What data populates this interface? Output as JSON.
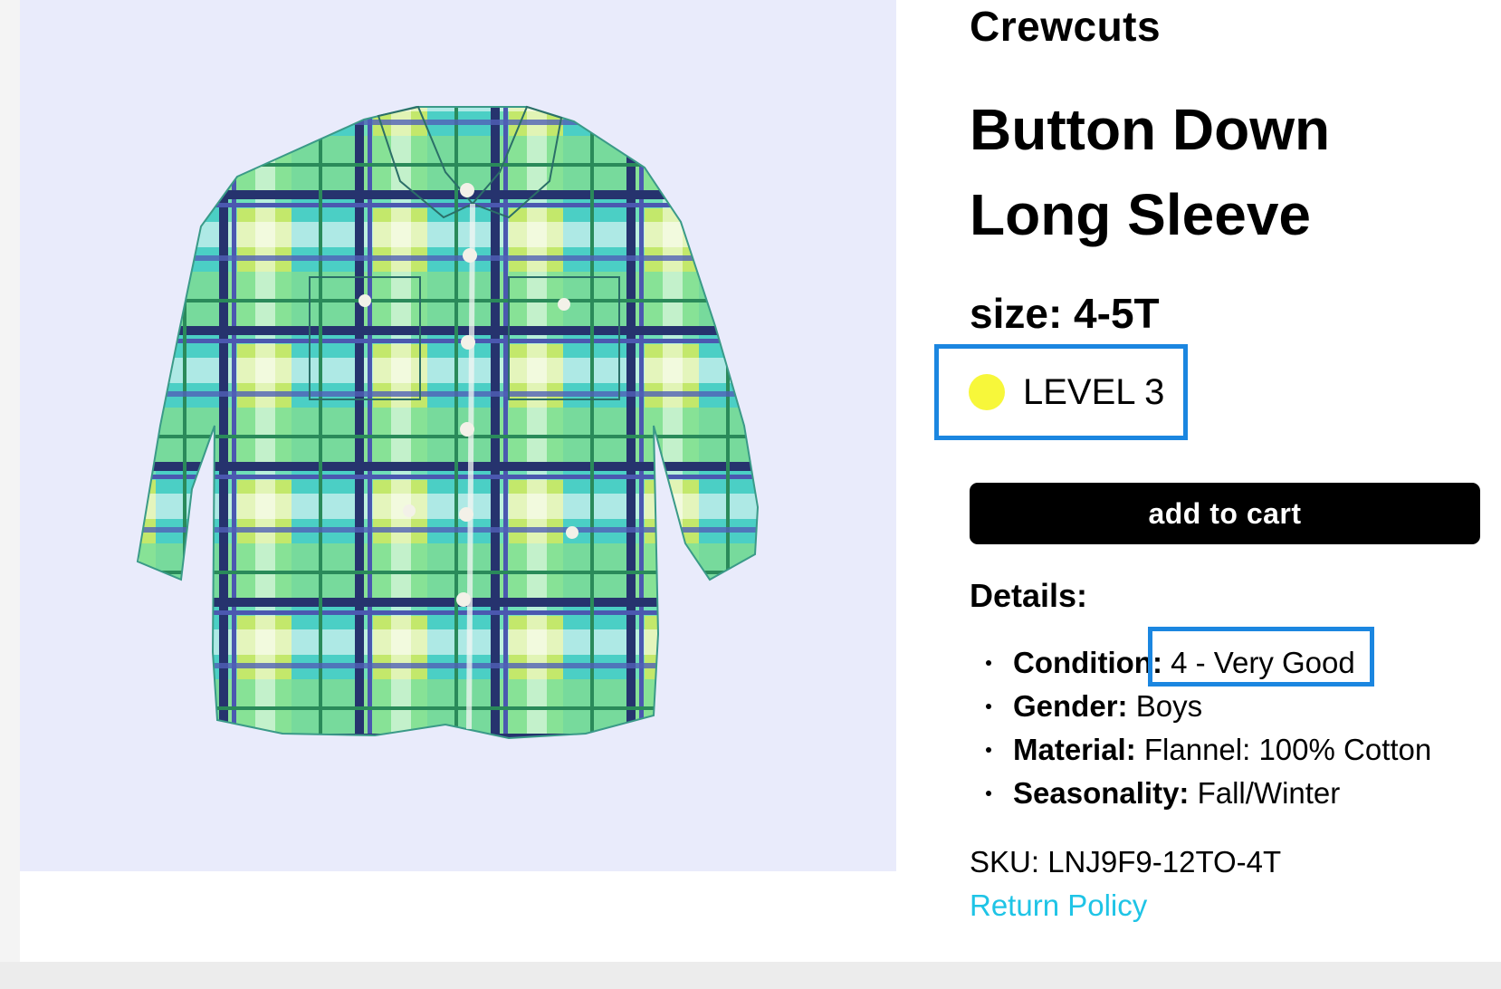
{
  "product": {
    "brand": "Crewcuts",
    "title": "Button Down Long Sleeve",
    "size_label": "size:",
    "size_value": "4-5T",
    "level_label": "LEVEL 3",
    "level_color": "#f7f73a",
    "image_alt": "plaid button down shirt photo"
  },
  "cart": {
    "button_label": "add to cart"
  },
  "details": {
    "heading": "Details:",
    "items": [
      {
        "label": "Condition:",
        "value": " 4 - Very Good"
      },
      {
        "label": "Gender:",
        "value": " Boys"
      },
      {
        "label": "Material:",
        "value": " Flannel: 100% Cotton"
      },
      {
        "label": "Seasonality:",
        "value": " Fall/Winter"
      }
    ]
  },
  "sku": {
    "label": "SKU:",
    "value": "LNJ9F9-12TO-4T"
  },
  "links": {
    "return_policy": "Return Policy"
  },
  "colors": {
    "highlight_box": "#1b86e0",
    "link": "#1fc4e6",
    "button_bg": "#000000",
    "photo_bg": "#e9ebfb"
  }
}
